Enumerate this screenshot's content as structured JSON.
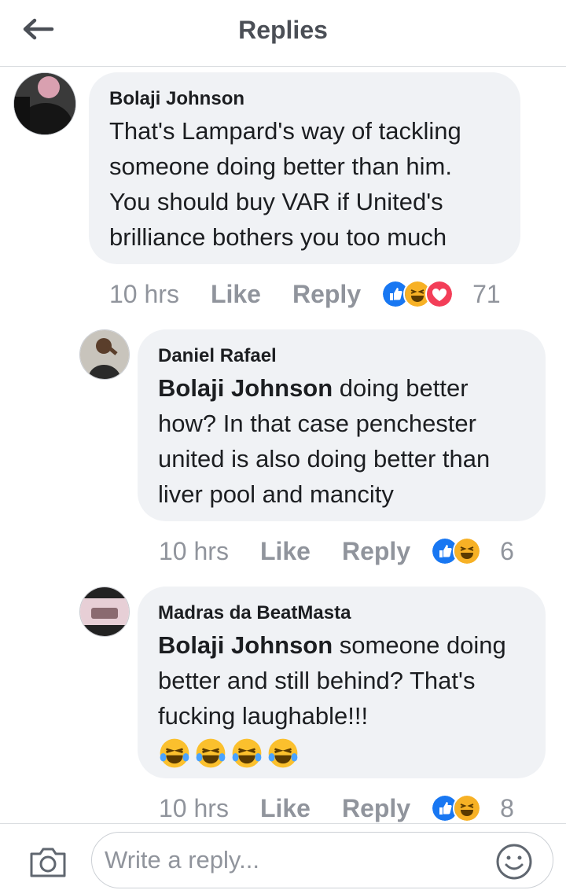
{
  "header": {
    "title": "Replies",
    "back_icon": "back-arrow-icon"
  },
  "colors": {
    "bubble": "#f0f2f5",
    "like_blue": "#1877f2",
    "love_red": "#f33e58",
    "haha_yellow": "#f7b125",
    "meta_gray": "#90949c"
  },
  "comments": [
    {
      "author": "Bolaji Johnson",
      "mention": "",
      "text_lines": [
        "That's Lampard's way of tackling",
        "someone doing better than him.",
        "You should buy VAR if United's",
        "brilliance bothers you too much"
      ],
      "time": "10 hrs",
      "like_label": "Like",
      "reply_label": "Reply",
      "reactions": [
        "like",
        "haha",
        "love"
      ],
      "reaction_count": "71"
    },
    {
      "author": "Daniel Rafael",
      "mention": "Bolaji Johnson",
      "text_lines": [
        " doing better",
        "how? In that case penchester",
        "united is also doing better than",
        "liver pool and mancity"
      ],
      "time": "10 hrs",
      "like_label": "Like",
      "reply_label": "Reply",
      "reactions": [
        "like",
        "haha"
      ],
      "reaction_count": "6"
    },
    {
      "author": "Madras da BeatMasta",
      "mention": "Bolaji Johnson",
      "text_lines": [
        " someone doing",
        "better and still behind? That's",
        "fucking laughable!!!"
      ],
      "emojis": [
        "😂",
        "😂",
        "😂",
        "😂"
      ],
      "time": "10 hrs",
      "like_label": "Like",
      "reply_label": "Reply",
      "reactions": [
        "like",
        "haha"
      ],
      "reaction_count": "8"
    }
  ],
  "composer": {
    "placeholder": "Write a reply...",
    "camera_icon": "camera-icon",
    "emoji_icon": "smiley-icon"
  }
}
